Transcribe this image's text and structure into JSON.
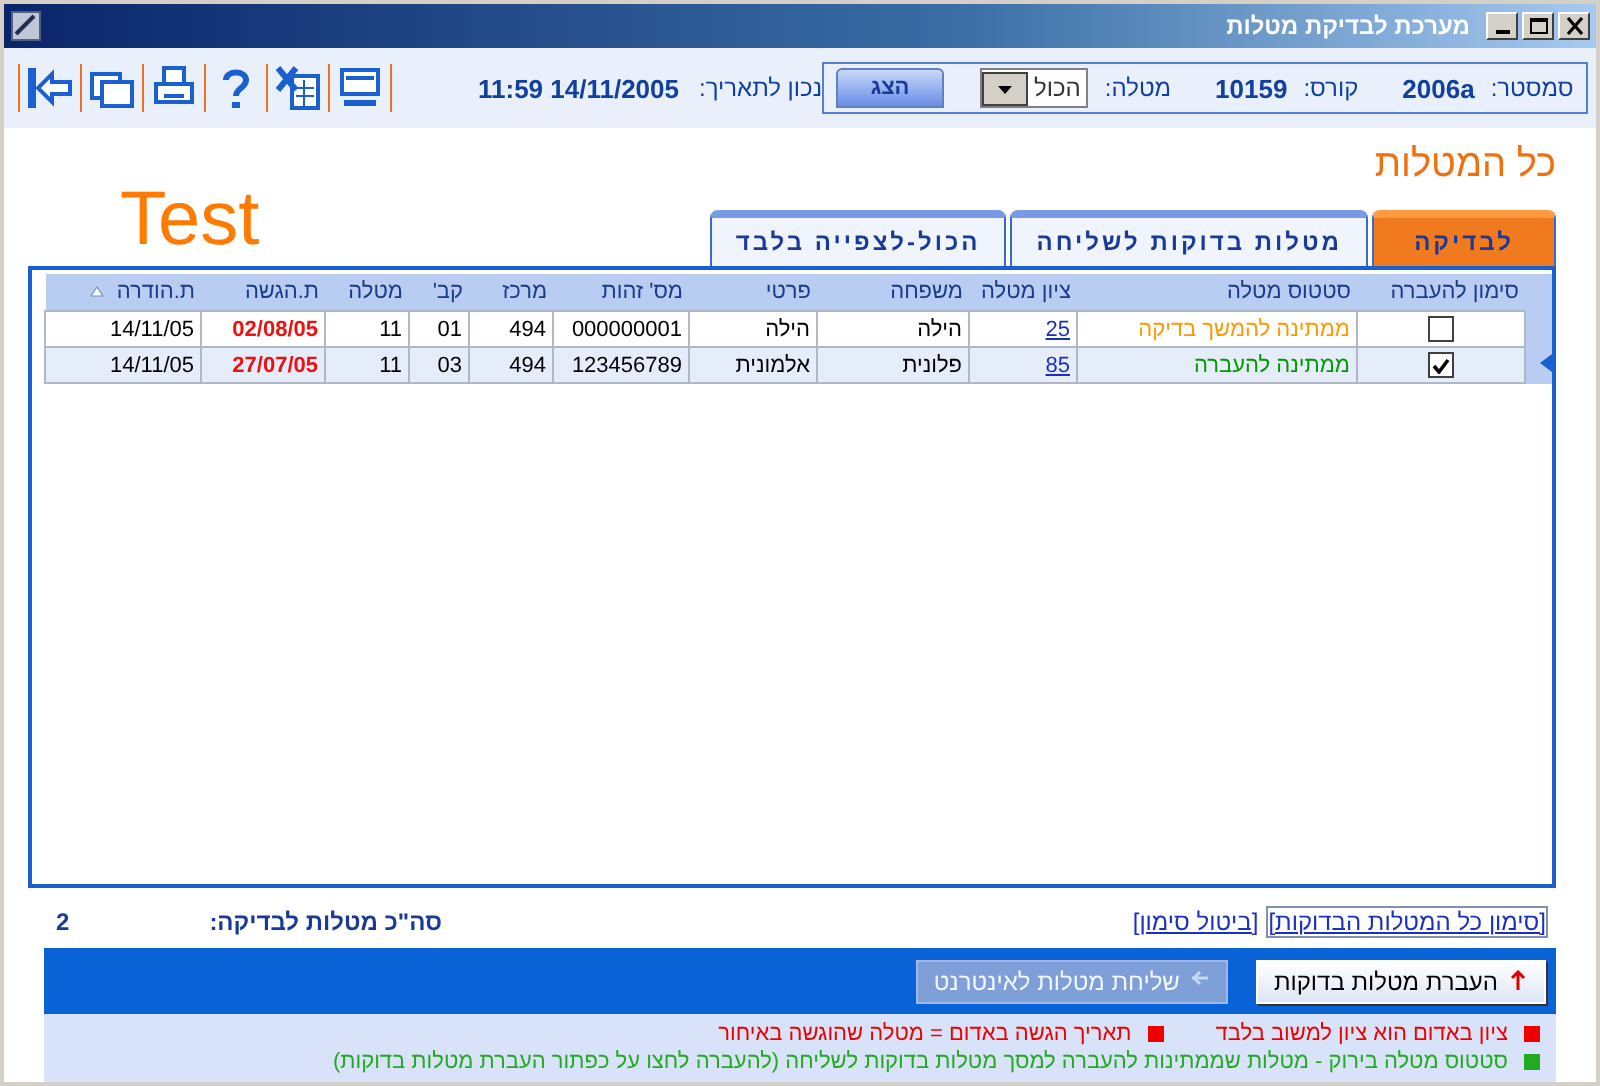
{
  "window": {
    "title": "מערכת לבדיקת מטלות"
  },
  "toolbar": {
    "date_label": "נכון לתאריך:",
    "date_value": "11:59 14/11/2005"
  },
  "filter": {
    "semester_label": "סמסטר:",
    "semester": "2006a",
    "course_label": "קורס:",
    "course": "10159",
    "task_label": "מטלה:",
    "task": "הכול",
    "show_button": "הצג"
  },
  "heading": "כל המטלות",
  "test_label": "Test",
  "tabs": [
    {
      "label": "לבדיקה",
      "selected": true
    },
    {
      "label": "מטלות בדוקות לשליחה",
      "selected": false
    },
    {
      "label": "הכול-לצפייה בלבד",
      "selected": false
    }
  ],
  "table": {
    "columns": [
      {
        "label": "סימון להעברה",
        "sorted": false
      },
      {
        "label": "סטטוס מטלה",
        "sorted": false
      },
      {
        "label": "ציון מטלה",
        "sorted": false
      },
      {
        "label": "משפחה",
        "sorted": false
      },
      {
        "label": "פרטי",
        "sorted": false
      },
      {
        "label": "מס' זהות",
        "sorted": false
      },
      {
        "label": "מרכז",
        "sorted": false
      },
      {
        "label": "קב'",
        "sorted": false
      },
      {
        "label": "מטלה",
        "sorted": false
      },
      {
        "label": "ת.הגשה",
        "sorted": false
      },
      {
        "label": "ת.הודרה",
        "sorted": true
      }
    ],
    "rows": [
      {
        "checked": false,
        "current": false,
        "status": "ממתינה להמשך בדיקה",
        "color": "#ff9900",
        "grade": "25",
        "last_name": "הילה",
        "first_name": "הילה",
        "id": "000000001",
        "center": "494",
        "group": "01",
        "task": "11",
        "submitted": "02/08/05",
        "late": true,
        "returned": "14/11/05"
      },
      {
        "checked": true,
        "current": true,
        "status": "ממתינה להעברה",
        "color": "#009900",
        "grade": "85",
        "last_name": "פלונית",
        "first_name": "אלמונית",
        "id": "123456789",
        "center": "494",
        "group": "03",
        "task": "11",
        "submitted": "27/07/05",
        "late": true,
        "returned": "14/11/05"
      }
    ]
  },
  "links": [
    "[סימון כל המטלות הבדוקות]",
    "[ביטול סימון]"
  ],
  "total": {
    "label": "סה\"כ מטלות לבדיקה:",
    "value": "2"
  },
  "buttons": [
    {
      "label": "העברת מטלות בדוקות",
      "disabled": false
    },
    {
      "label": "שליחת מטלות לאינטרנט",
      "disabled": true
    }
  ],
  "legend": [
    {
      "items": [
        {
          "text": "ציון באדום הוא ציון למשוב בלבד",
          "color": "#ee0000"
        },
        {
          "text": "תאריך הגשה באדום = מטלה שהוגשה באיחור",
          "color": "#ee0000"
        }
      ]
    },
    {
      "items": [
        {
          "text": "סטטוס מטלה בירוק - מטלות שממתינות להעברה למסך מטלות בדוקות לשליחה (להעברה לחצו על כפתור העברת מטלות בדוקות)",
          "color": "#22aa22"
        }
      ]
    }
  ]
}
